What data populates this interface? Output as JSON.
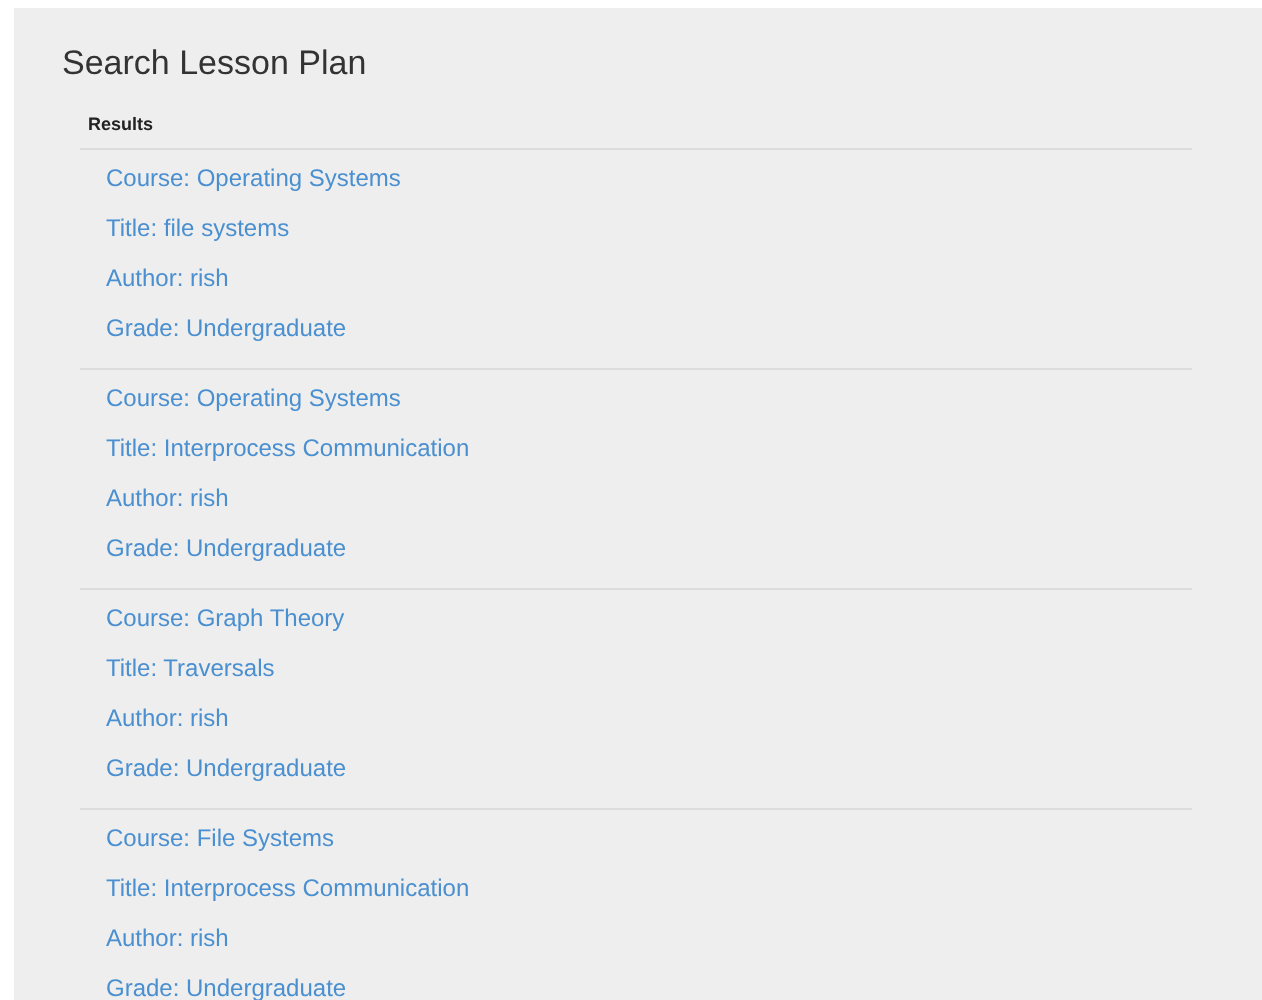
{
  "page": {
    "title": "Search Lesson Plan"
  },
  "results": {
    "heading": "Results",
    "items": [
      {
        "lines": [
          "Course: Operating Systems",
          "Title: file systems",
          "Author: rish",
          "Grade: Undergraduate"
        ]
      },
      {
        "lines": [
          "Course: Operating Systems",
          "Title: Interprocess Communication",
          "Author: rish",
          "Grade: Undergraduate"
        ]
      },
      {
        "lines": [
          "Course: Graph Theory",
          "Title: Traversals",
          "Author: rish",
          "Grade: Undergraduate"
        ]
      },
      {
        "lines": [
          "Course: File Systems",
          "Title: Interprocess Communication",
          "Author: rish",
          "Grade: Undergraduate"
        ]
      }
    ]
  }
}
